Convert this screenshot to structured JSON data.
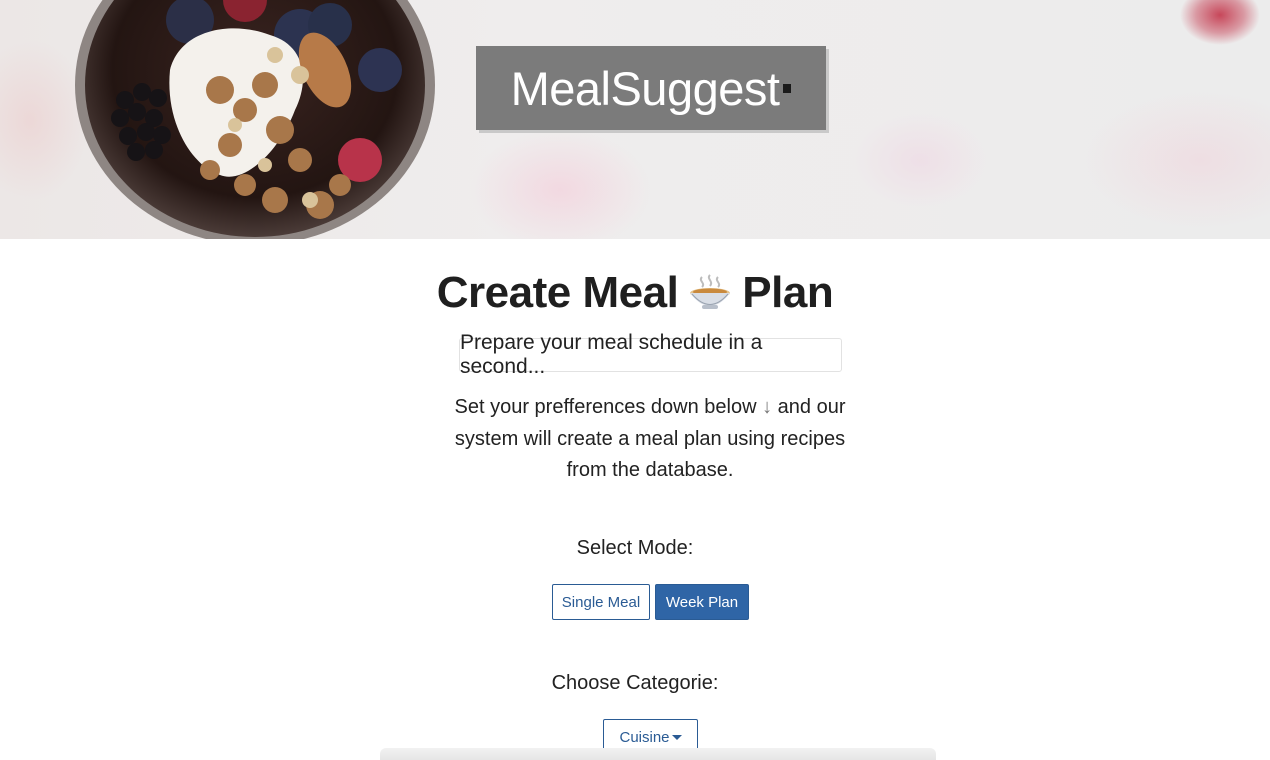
{
  "header": {
    "logo_text": "MealSuggest",
    "hero_image": "granola-berry-yogurt-jar"
  },
  "main": {
    "title_part1": "Create Meal",
    "title_icon": "bowl-icon",
    "title_part2": "Plan",
    "subtitle": "Prepare your meal schedule in a second...",
    "description_line1": "Set your prefferences down below",
    "description_arrow": "↓",
    "description_after_arrow": "and",
    "description_rest": "our system will create a meal plan using recipes from the database."
  },
  "mode": {
    "label": "Select Mode:",
    "options": [
      {
        "label": "Single Meal",
        "selected": false
      },
      {
        "label": "Week Plan",
        "selected": true
      }
    ]
  },
  "category": {
    "label": "Choose Categorie:",
    "dropdown_label": "Cuisine"
  },
  "colors": {
    "accent": "#2f65a6",
    "logo_bg": "#7b7b7b"
  }
}
